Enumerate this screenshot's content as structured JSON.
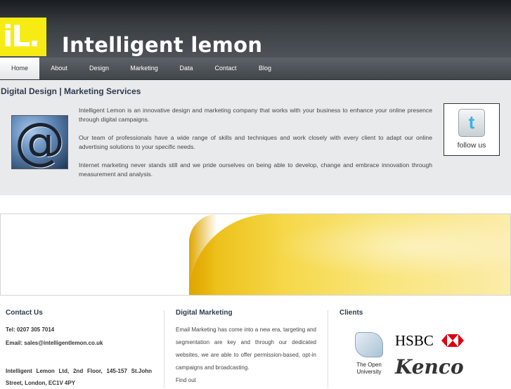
{
  "header": {
    "logo_text": "iL.",
    "site_title": "Intelligent lemon",
    "brand_color": "#f6ec14"
  },
  "nav": {
    "items": [
      {
        "label": "Home",
        "active": true
      },
      {
        "label": "About",
        "active": false
      },
      {
        "label": "Design",
        "active": false
      },
      {
        "label": "Marketing",
        "active": false
      },
      {
        "label": "Data",
        "active": false
      },
      {
        "label": "Contact",
        "active": false
      },
      {
        "label": "Blog",
        "active": false
      }
    ]
  },
  "intro": {
    "title": "Digital Design | Marketing Services",
    "photo_icon": "at-sign-icon",
    "paragraphs": [
      "Intelligent Lemon is an innovative design and marketing company that works with your business to enhance your online presence through digital campaigns.",
      "Our team of professionals have a wide range of skills and techniques and work closely with every client to adapt our online advertising solutions to your specific needs.",
      "Internet marketing never stands still and we pride ourselves on being able to develop, change and embrace innovation through measurement and analysis."
    ],
    "twitter": {
      "icon": "twitter-icon",
      "label": "follow us"
    }
  },
  "banner": {
    "image": "lemon-slice-photo"
  },
  "footer": {
    "contact": {
      "heading": "Contact Us",
      "tel": "Tel: 0207 305 7014",
      "email": "Email: sales@intelligentlemon.co.uk",
      "address": "Intelligent Lemon Ltd, 2nd Floor, 145-157 St.John Street, London, EC1V 4PY"
    },
    "digital": {
      "heading": "Digital Marketing",
      "body": "Email Marketing has come into a new era, targeting and segmentation are key and through our dedicated websites, we are able to offer permission-based, opt-in campaigns and broadcasting.",
      "more": "Find out"
    },
    "clients": {
      "heading": "Clients",
      "open_university": "The Open University",
      "hsbc": "HSBC",
      "kenco": "Kenco"
    }
  }
}
